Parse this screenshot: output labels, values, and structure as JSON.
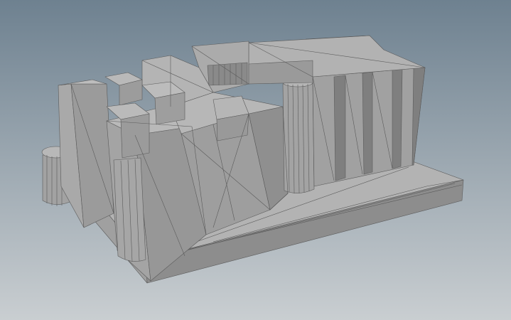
{
  "viewport": {
    "background_top": "#6e8190",
    "background_bottom": "#c9ced1",
    "mesh_light": "#b0b0b0",
    "mesh_mid": "#9a9a9a",
    "mesh_dark": "#858585",
    "wire": "#5a5a5a"
  },
  "model": {
    "kind": "triangulated-architectural-mesh",
    "shading": "flat-gray",
    "wireframe": "on"
  }
}
